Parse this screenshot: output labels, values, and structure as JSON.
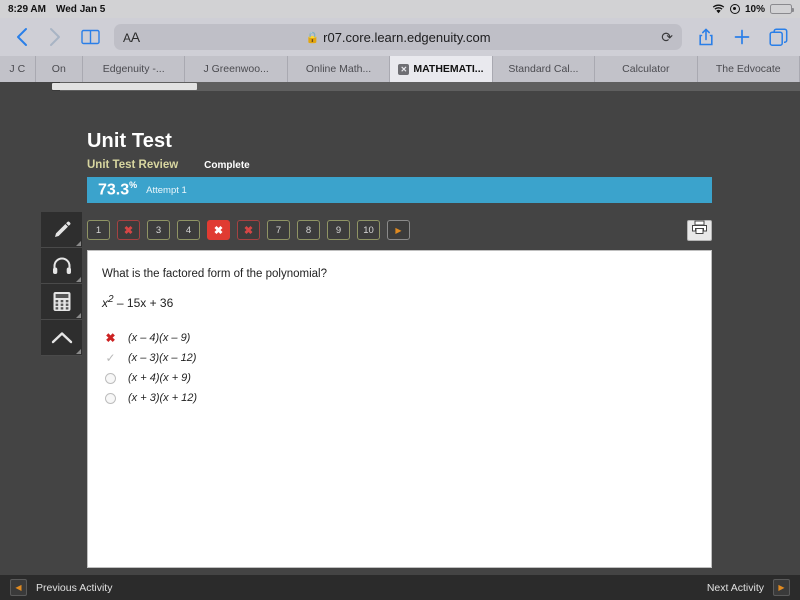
{
  "status_bar": {
    "time": "8:29 AM",
    "date": "Wed Jan 5",
    "battery_percent": "10%",
    "wifi_icon": "wifi-icon",
    "location_icon": "location-icon",
    "battery_icon": "battery-icon"
  },
  "browser": {
    "back_icon": "chevron-left-icon",
    "forward_icon": "chevron-right-icon",
    "bookmarks_icon": "book-icon",
    "text_size_label": "A",
    "text_size_label_big": "A",
    "lock_glyph": "ὑ2",
    "url": "r07.core.learn.edgenuity.com",
    "reload_icon": "reload-icon",
    "share_icon": "share-icon",
    "new_tab_icon": "plus-icon",
    "tab_overview_icon": "tabs-icon"
  },
  "tabs": [
    {
      "label": "J C",
      "active": false,
      "width": 36
    },
    {
      "label": "On",
      "active": false,
      "width": 48
    },
    {
      "label": "Edgenuity -...",
      "active": false,
      "width": 104
    },
    {
      "label": "J Greenwoo...",
      "active": false,
      "width": 104
    },
    {
      "label": "Online Math...",
      "active": false,
      "width": 104
    },
    {
      "label": "MATHEMATI...",
      "active": true,
      "width": 104,
      "close_glyph": "✕"
    },
    {
      "label": "Standard Cal...",
      "active": false,
      "width": 104
    },
    {
      "label": "Calculator",
      "active": false,
      "width": 104
    },
    {
      "label": "The Edvocate",
      "active": false,
      "width": 104
    }
  ],
  "course": {
    "title": "Unit Test",
    "subtitle": "Unit Test Review",
    "status": "Complete",
    "score": "73.3",
    "score_unit": "%",
    "attempt": "Attempt 1",
    "accent_color": "#3ba3cc",
    "subtitle_color": "#d8d6a0"
  },
  "tools": [
    {
      "name": "pencil-tool",
      "icon": "pencil-icon"
    },
    {
      "name": "audio-tool",
      "icon": "headphones-icon"
    },
    {
      "name": "calculator-tool",
      "icon": "calculator-icon"
    },
    {
      "name": "collapse-tool",
      "icon": "arrow-up-icon"
    }
  ],
  "question_nav": {
    "items": [
      {
        "label": "1",
        "state": "normal"
      },
      {
        "label": "✖",
        "state": "wrong"
      },
      {
        "label": "3",
        "state": "normal"
      },
      {
        "label": "4",
        "state": "normal"
      },
      {
        "label": "✖",
        "state": "current"
      },
      {
        "label": "✖",
        "state": "wrong"
      },
      {
        "label": "7",
        "state": "normal"
      },
      {
        "label": "8",
        "state": "normal"
      },
      {
        "label": "9",
        "state": "normal"
      },
      {
        "label": "10",
        "state": "normal"
      },
      {
        "label": "▶",
        "state": "next"
      }
    ],
    "print_icon": "printer-icon"
  },
  "question": {
    "prompt": "What is the factored form of the polynomial?",
    "expression_base": "x",
    "expression_exp": "2",
    "expression_rest": " – 15x + 36",
    "options": [
      {
        "mark": "x",
        "glyph": "✖",
        "text": "(x – 4)(x – 9)"
      },
      {
        "mark": "check",
        "glyph": "✓",
        "text": "(x – 3)(x – 12)"
      },
      {
        "mark": "radio",
        "glyph": "",
        "text": "(x + 4)(x + 9)"
      },
      {
        "mark": "radio",
        "glyph": "",
        "text": "(x + 3)(x + 12)"
      }
    ]
  },
  "bottom_bar": {
    "previous_label": "Previous Activity",
    "previous_glyph": "◀",
    "next_label": "Next Activity",
    "next_glyph": "▶"
  }
}
